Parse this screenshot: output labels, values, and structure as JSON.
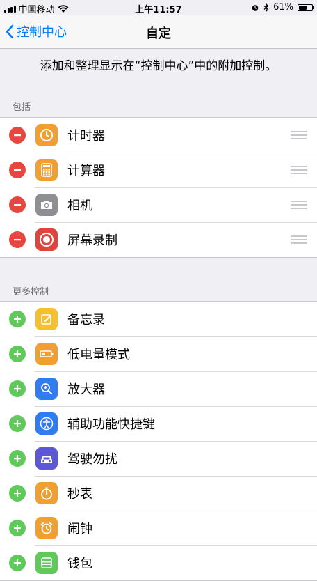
{
  "status_bar": {
    "carrier": "中国移动",
    "time": "上午11:57",
    "battery": "61%",
    "battery_level": 0.61,
    "icons": [
      "signal-icon",
      "wifi-icon",
      "alarm-icon",
      "bluetooth-icon",
      "battery-icon"
    ]
  },
  "nav": {
    "back_label": "控制中心",
    "title": "自定"
  },
  "description": "添加和整理显示在“控制中心”中的附加控制。",
  "included": {
    "header": "包括",
    "items": [
      {
        "label": "计时器",
        "icon": "timer-icon",
        "color": "#f0a030"
      },
      {
        "label": "计算器",
        "icon": "calculator-icon",
        "color": "#f0a030"
      },
      {
        "label": "相机",
        "icon": "camera-icon",
        "color": "#8e8e93"
      },
      {
        "label": "屏幕录制",
        "icon": "screen-record-icon",
        "color": "#e0443e"
      }
    ]
  },
  "more": {
    "header": "更多控制",
    "items": [
      {
        "label": "备忘录",
        "icon": "notes-icon",
        "color": "#f5c02e"
      },
      {
        "label": "低电量模式",
        "icon": "low-power-icon",
        "color": "#f0a030"
      },
      {
        "label": "放大器",
        "icon": "magnifier-icon",
        "color": "#2f7df0"
      },
      {
        "label": "辅助功能快捷键",
        "icon": "accessibility-icon",
        "color": "#2f7df0"
      },
      {
        "label": "驾驶勿扰",
        "icon": "car-icon",
        "color": "#5b57d6"
      },
      {
        "label": "秒表",
        "icon": "stopwatch-icon",
        "color": "#f0a030"
      },
      {
        "label": "闹钟",
        "icon": "alarm-clock-icon",
        "color": "#f0a030"
      },
      {
        "label": "钱包",
        "icon": "wallet-icon",
        "color": "#5fc95a"
      }
    ]
  }
}
